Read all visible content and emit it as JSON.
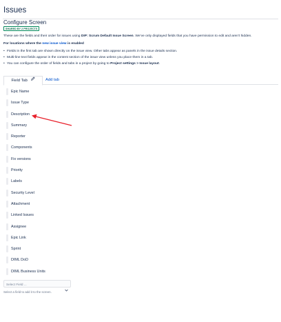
{
  "page": {
    "title": "Issues",
    "subtitle": "Configure Screen",
    "shared_badge": "SHARED BY 2 PROJECTS"
  },
  "description": {
    "pre": "These are the fields and their order for issues using ",
    "screen_name": "DIP: Scrum Default Issue Screen",
    "post": ". We've only displayed fields that you have permission to edit and aren't hidden."
  },
  "locations": {
    "pre": "For locations where the ",
    "link": "new issue view",
    "post": " is enabled"
  },
  "bullets": [
    {
      "text": "Fields in the first tab are shown directly on the issue view. Other tabs appear as panels in the issue details section."
    },
    {
      "text": "Multi-line text fields appear in the content section of the issue view unless you place them in a tab."
    },
    {
      "pre": "You can configure the order of fields and tabs in a project by going to ",
      "bold": "Project settings > Issue layout",
      "post": "."
    }
  ],
  "tabs": {
    "active": "Field Tab",
    "add": "Add tab"
  },
  "fields": [
    "Epic Name",
    "Issue Type",
    "Description",
    "Summary",
    "Reporter",
    "Components",
    "Fix versions",
    "Priority",
    "Labels",
    "Security Level",
    "Attachment",
    "Linked Issues",
    "Assignee",
    "Epic Link",
    "Sprint",
    "DIML DoD",
    "DIML Business Units"
  ],
  "select": {
    "placeholder": "Select Field ...",
    "hint": "Select a field to add it to the screen."
  },
  "colors": {
    "link": "#0052cc",
    "badge": "#00875a",
    "annotation_arrow": "#e8202a"
  },
  "icons": {
    "tab_edit": "pencil-icon",
    "select_open": "chevron-down-icon"
  }
}
